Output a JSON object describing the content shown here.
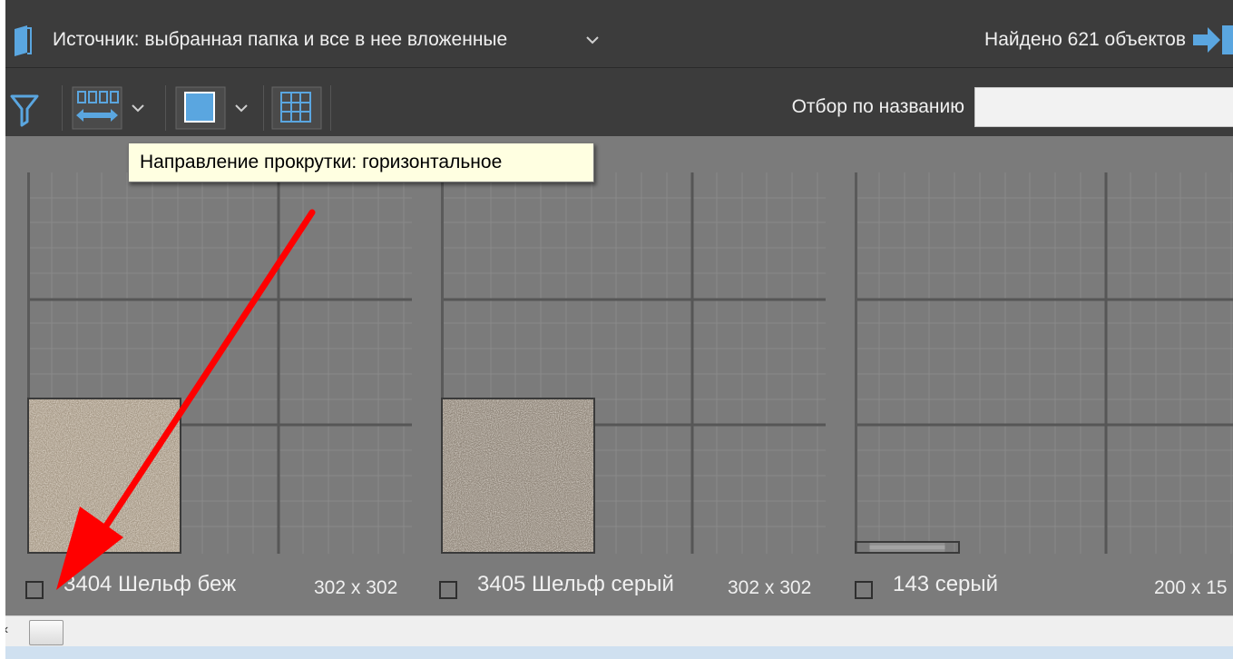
{
  "header": {
    "source_label": "Источник: выбранная папка и все в нее вложенные",
    "found_label": "Найдено 621 объектов"
  },
  "toolbar": {
    "filter_label": "Отбор по названию",
    "filter_value": ""
  },
  "tooltip": {
    "text": "Направление прокрутки: горизонтальное"
  },
  "items": [
    {
      "name": "3404 Шельф беж",
      "size": "302 x 302"
    },
    {
      "name": "3405 Шельф серый",
      "size": "302 x 302"
    },
    {
      "name": "143 серый",
      "size": "200 x 15"
    }
  ],
  "colors": {
    "header_bg": "#3c3c3c",
    "content_bg": "#7b7b7b",
    "icon_blue": "#5aa6e0",
    "annotation_red": "#ff0000",
    "tooltip_bg": "#ffffe1"
  }
}
